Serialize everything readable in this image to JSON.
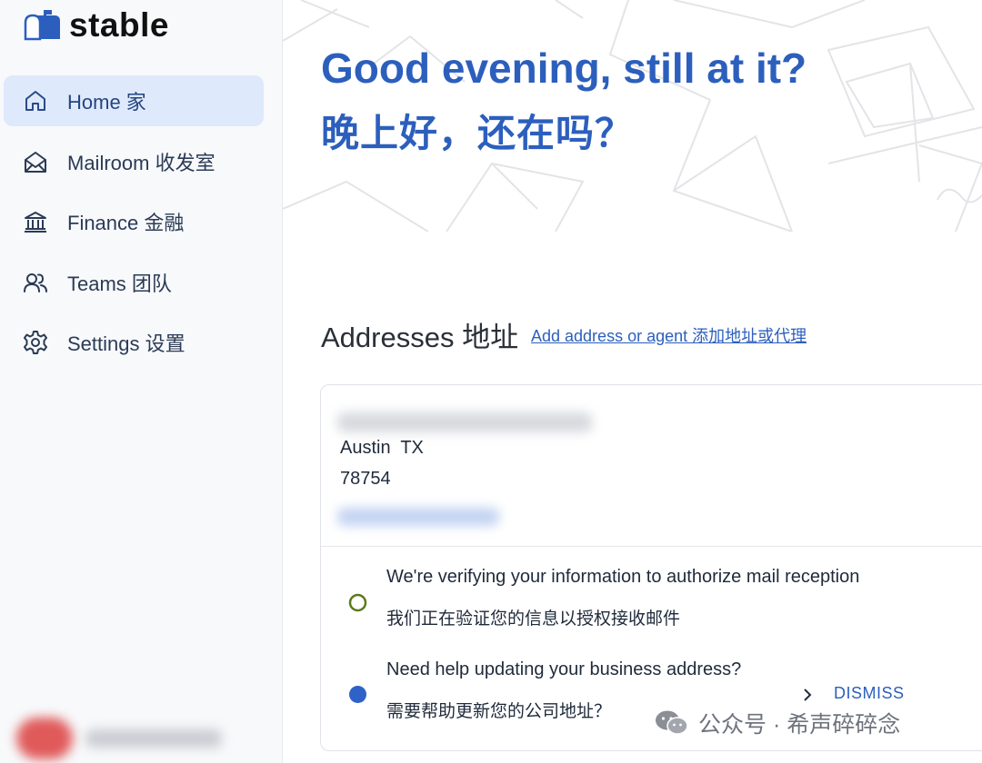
{
  "app": {
    "name": "stable"
  },
  "sidebar": {
    "items": [
      {
        "label": "Home 家",
        "icon": "home-icon",
        "active": true
      },
      {
        "label": "Mailroom 收发室",
        "icon": "envelope-open-icon",
        "active": false
      },
      {
        "label": "Finance 金融",
        "icon": "bank-icon",
        "active": false
      },
      {
        "label": "Teams 团队",
        "icon": "users-icon",
        "active": false
      },
      {
        "label": "Settings 设置",
        "icon": "gear-icon",
        "active": false
      }
    ]
  },
  "hero": {
    "greeting_en": "Good evening, still at it?",
    "greeting_zh": "晚上好，还在吗？"
  },
  "addresses": {
    "title": "Addresses 地址",
    "add_link": "Add address or agent 添加地址或代理",
    "card": {
      "city_state": "Austin  TX",
      "zip": "78754",
      "statuses": [
        {
          "icon": "pending-circle-icon",
          "text_en": "We're verifying your information to authorize mail reception",
          "text_zh": "我们正在验证您的信息以授权接收邮件"
        },
        {
          "icon": "info-dot-icon",
          "text_en": "Need help updating your business address?",
          "text_zh": "需要帮助更新您的公司地址？",
          "action": "DISMISS"
        }
      ]
    }
  },
  "watermark": {
    "text": "公众号 · 希声碎碎念"
  },
  "colors": {
    "brand_blue": "#2c5fbd",
    "active_nav_bg": "#dfe9fc",
    "status_green": "#5c7a1a",
    "status_blue": "#2f62c6"
  }
}
